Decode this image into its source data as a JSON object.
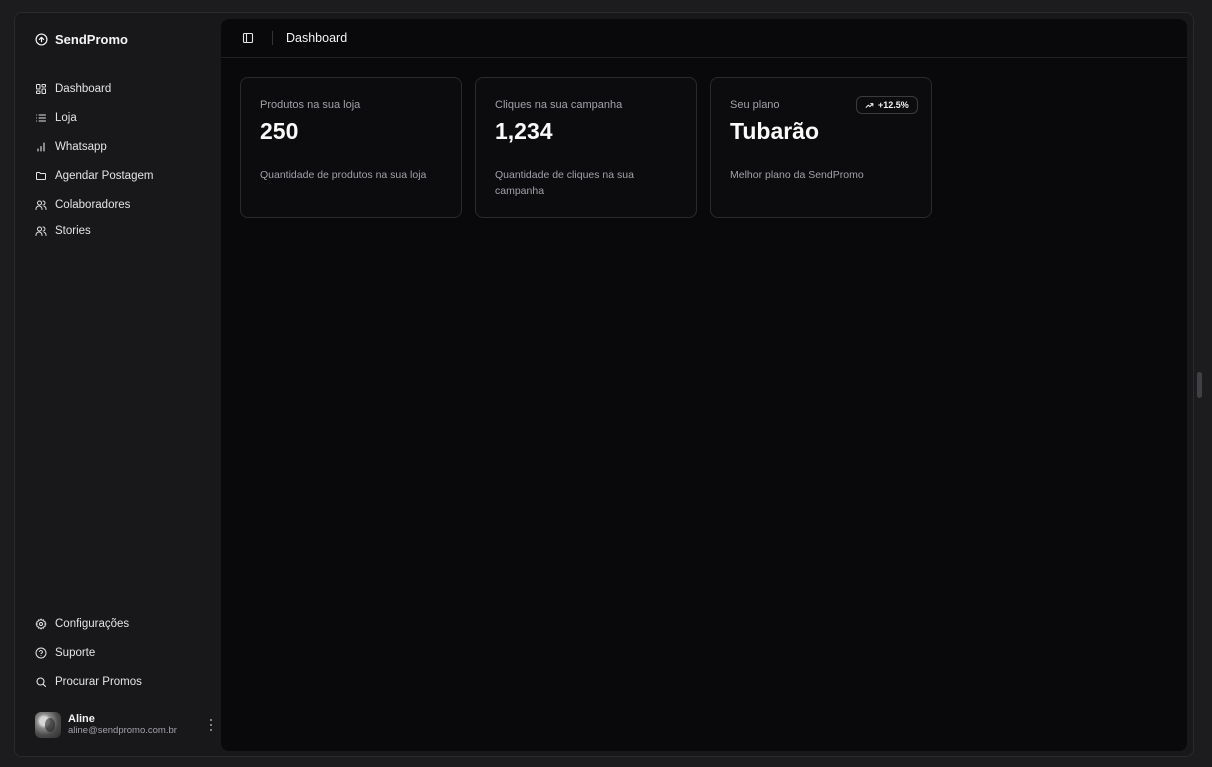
{
  "brand": {
    "name": "SendPromo",
    "icon": "circle-arrow-up-icon"
  },
  "sidebar": {
    "items": [
      {
        "label": "Dashboard",
        "icon": "grid-icon"
      },
      {
        "label": "Loja",
        "icon": "list-icon"
      },
      {
        "label": "Whatsapp",
        "icon": "bar-chart-icon"
      },
      {
        "label": "Agendar Postagem",
        "icon": "folder-icon"
      },
      {
        "label": "Colaboradores",
        "icon": "users-icon"
      },
      {
        "label": "Stories",
        "icon": "users-icon"
      }
    ],
    "bottom_items": [
      {
        "label": "Configurações",
        "icon": "gear-icon"
      },
      {
        "label": "Suporte",
        "icon": "help-circle-icon"
      },
      {
        "label": "Procurar Promos",
        "icon": "search-icon"
      }
    ]
  },
  "user": {
    "name": "Aline",
    "email": "aline@sendpromo.com.br"
  },
  "header": {
    "title": "Dashboard"
  },
  "cards": [
    {
      "label": "Produtos na sua loja",
      "value": "250",
      "description": "Quantidade de produtos na sua loja"
    },
    {
      "label": "Cliques na sua campanha",
      "value": "1,234",
      "description": "Quantidade de cliques na sua campanha"
    },
    {
      "label": "Seu plano",
      "value": "Tubarão",
      "description": "Melhor plano da SendPromo",
      "badge": "+12.5%"
    }
  ],
  "colors": {
    "background": "#09090b",
    "sidebar": "#18181b",
    "text": "#f4f4f5",
    "muted": "#a1a1aa"
  }
}
